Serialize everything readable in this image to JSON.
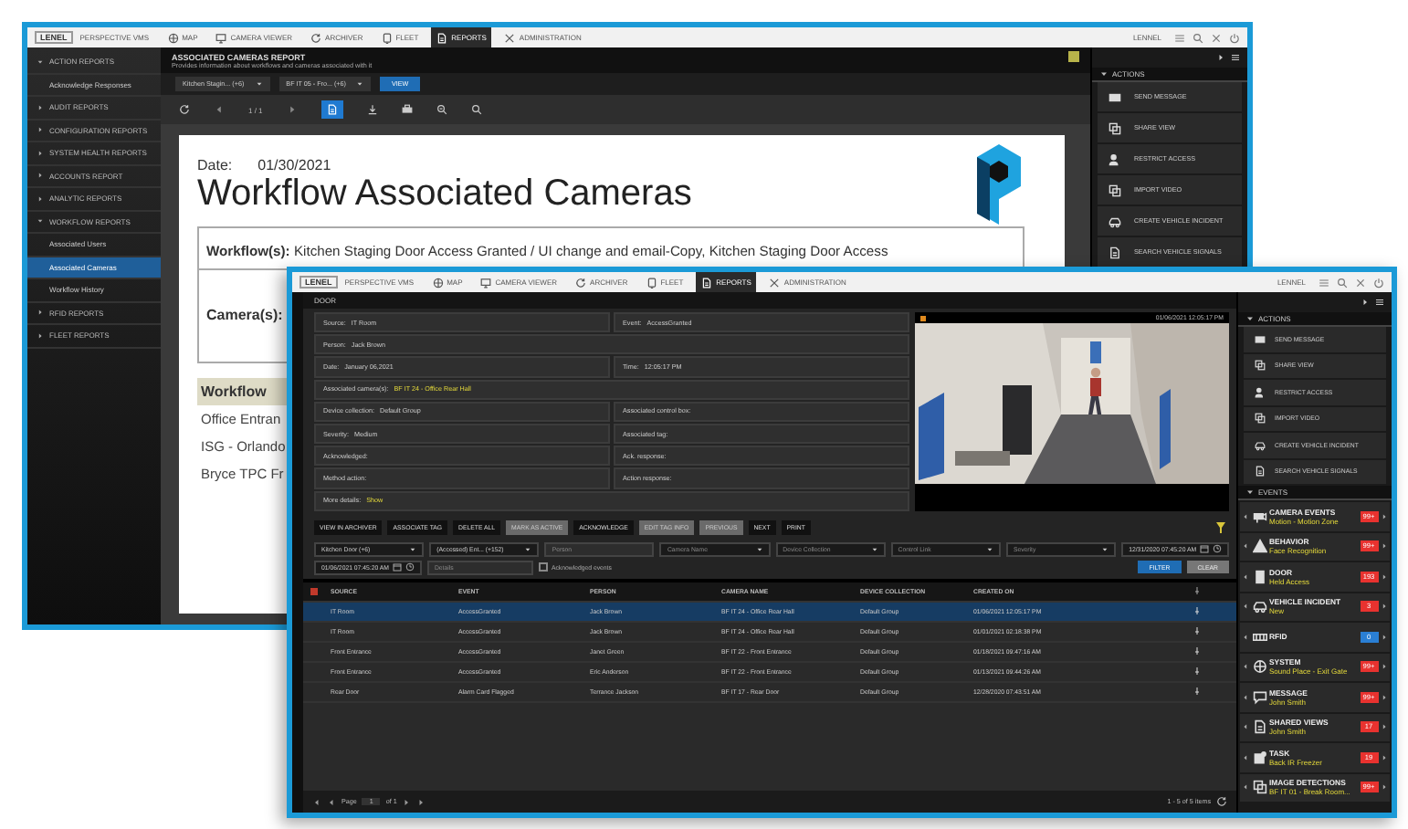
{
  "back_window": {
    "nav": {
      "logo": "LENEL",
      "app": "PERSPECTIVE VMS",
      "user": "LENNEL",
      "tabs": [
        {
          "label": "MAP",
          "selected": false
        },
        {
          "label": "CAMERA VIEWER",
          "selected": false
        },
        {
          "label": "ARCHIVER",
          "selected": false
        },
        {
          "label": "FLEET",
          "selected": false
        },
        {
          "label": "REPORTS",
          "selected": true
        },
        {
          "label": "ADMINISTRATION",
          "selected": false
        }
      ]
    },
    "sidebar": {
      "items": [
        {
          "label": "ACTION REPORTS",
          "selected": false,
          "expanded": true,
          "children": [
            {
              "label": "Acknowledge Responses",
              "selected": false
            }
          ]
        },
        {
          "label": "AUDIT REPORTS",
          "selected": false,
          "expanded": false
        },
        {
          "label": "CONFIGURATION REPORTS",
          "selected": false,
          "expanded": false
        },
        {
          "label": "SYSTEM HEALTH REPORTS",
          "selected": false,
          "expanded": false
        },
        {
          "label": "ACCOUNTS REPORT",
          "selected": false,
          "expanded": false
        },
        {
          "label": "ANALYTIC REPORTS",
          "selected": false,
          "expanded": false
        },
        {
          "label": "WORKFLOW REPORTS",
          "selected": false,
          "expanded": true,
          "children": [
            {
              "label": "Associated Users",
              "selected": false
            },
            {
              "label": "Associated Cameras",
              "selected": true
            },
            {
              "label": "Workflow History",
              "selected": false
            }
          ]
        },
        {
          "label": "RFID REPORTS",
          "selected": false,
          "expanded": false
        },
        {
          "label": "FLEET REPORTS",
          "selected": false,
          "expanded": false
        }
      ]
    },
    "report": {
      "title": "ASSOCIATED CAMERAS REPORT",
      "description": "Provides information about workflows and cameras associated with it",
      "filters": [
        "Kitchen Stagin... (+6)",
        "BF IT 05 - Fro... (+6)"
      ],
      "view_button": "VIEW",
      "page": "1 / 1",
      "document": {
        "date_label": "Date:",
        "date": "01/30/2021",
        "heading": "Workflow Associated Cameras",
        "workflow": "**Workflow(s):** Kitchen Staging Door Access Granted / UI change and email-Copy, Kitchen Staging Door Access",
        "cameras_label": "Camera(s):",
        "table_header": "Workflow",
        "rows": [
          "Office Entran",
          "ISG - Orlando",
          "Bryce TPC Fr"
        ]
      }
    },
    "actions": {
      "title": "ACTIONS",
      "items": [
        "SEND MESSAGE",
        "SHARE VIEW",
        "RESTRICT ACCESS",
        "IMPORT VIDEO",
        "CREATE VEHICLE INCIDENT",
        "SEARCH VEHICLE SIGNALS"
      ]
    }
  },
  "front_window": {
    "nav": {
      "logo": "LENEL",
      "app": "PERSPECTIVE VMS",
      "user": "LENNEL",
      "tabs": [
        {
          "label": "MAP",
          "selected": false
        },
        {
          "label": "CAMERA VIEWER",
          "selected": false
        },
        {
          "label": "ARCHIVER",
          "selected": false
        },
        {
          "label": "FLEET",
          "selected": false
        },
        {
          "label": "REPORTS",
          "selected": true
        },
        {
          "label": "ADMINISTRATION",
          "selected": false
        }
      ]
    },
    "section_title": "DOOR",
    "details": [
      {
        "cells": [
          {
            "label": "Source:",
            "value": "IT Room",
            "kind": "text"
          },
          {
            "label": "Event:",
            "value": "AccessGranted",
            "kind": "text"
          }
        ]
      },
      {
        "cells": [
          {
            "label": "Person:",
            "value": "Jack Brown",
            "kind": "text"
          }
        ]
      },
      {
        "cells": [
          {
            "label": "Date:",
            "value": "January 06,2021",
            "kind": "text"
          },
          {
            "label": "Time:",
            "value": "12:05:17 PM",
            "kind": "text"
          }
        ]
      },
      {
        "cells": [
          {
            "label": "Associated camera(s):",
            "value": "BF IT 24 - Office Rear Hall",
            "kind": "link"
          }
        ]
      },
      {
        "cells": [
          {
            "label": "Device collection:",
            "value": "Default Group",
            "kind": "text"
          },
          {
            "label": "Associated control box:"
          }
        ]
      },
      {
        "cells": [
          {
            "label": "Severity:",
            "value": "Medium",
            "kind": "text"
          },
          {
            "label": "Associated tag:"
          }
        ]
      },
      {
        "cells": [
          {
            "label": "Acknowledged:"
          },
          {
            "label": "Ack. response:"
          }
        ]
      },
      {
        "cells": [
          {
            "label": "Method action:"
          },
          {
            "label": "Action response:"
          }
        ]
      },
      {
        "cells": [
          {
            "label": "More details:",
            "value": "Show",
            "kind": "link"
          }
        ]
      }
    ],
    "video": {
      "timestamp": "01/06/2021 12:05:17 PM"
    },
    "toolbar": [
      {
        "label": "VIEW IN ARCHIVER",
        "disabled": false
      },
      {
        "label": "ASSOCIATE TAG",
        "disabled": false
      },
      {
        "label": "DELETE ALL",
        "disabled": false
      },
      {
        "label": "MARK AS ACTIVE",
        "disabled": true
      },
      {
        "label": "ACKNOWLEDGE",
        "disabled": false
      },
      {
        "label": "EDIT TAG INFO",
        "disabled": true
      },
      {
        "label": "PREVIOUS",
        "disabled": true
      },
      {
        "label": "NEXT",
        "disabled": false
      },
      {
        "label": "PRINT",
        "disabled": false
      }
    ],
    "filters": [
      {
        "kind": "dropdown",
        "value": "Kitchen Door (+6)"
      },
      {
        "kind": "dropdown",
        "value": "(Accessed) Ent... (+152)"
      },
      {
        "kind": "field",
        "placeholder": "Person"
      },
      {
        "kind": "dropdown",
        "placeholder": "Camera Name"
      },
      {
        "kind": "dropdown",
        "placeholder": "Device Collection"
      },
      {
        "kind": "dropdown",
        "placeholder": "Control Link"
      },
      {
        "kind": "dropdown",
        "placeholder": "Severity"
      },
      {
        "kind": "date",
        "value": "12/31/2020 07:45:20 AM"
      }
    ],
    "filters_row2": {
      "date": "01/06/2021 07:45:20 AM",
      "details_placeholder": "Details",
      "checkbox": {
        "label": "Acknowledged events",
        "checked": false
      }
    },
    "filter_button": "FILTER",
    "clear_button": "CLEAR",
    "table": {
      "columns": [
        "SOURCE",
        "EVENT",
        "PERSON",
        "CAMERA NAME",
        "DEVICE COLLECTION",
        "CREATED ON"
      ],
      "rows": [
        {
          "selected": true,
          "cells": [
            "IT Room",
            "AccessGranted",
            "Jack Brown",
            "BF IT 24 - Office Rear Hall",
            "Default Group",
            "01/06/2021 12:05:17 PM"
          ]
        },
        {
          "selected": false,
          "cells": [
            "IT Room",
            "AccessGranted",
            "Jack Brown",
            "BF IT 24 - Office Rear Hall",
            "Default Group",
            "01/01/2021 02:18:38 PM"
          ]
        },
        {
          "selected": false,
          "cells": [
            "Front Entrance",
            "AccessGranted",
            "Janet Green",
            "BF IT 22 - Front Entrance",
            "Default Group",
            "01/18/2021 09:47:16 AM"
          ]
        },
        {
          "selected": false,
          "cells": [
            "Front Entrance",
            "AccessGranted",
            "Eric Anderson",
            "BF IT 22 - Front Entrance",
            "Default Group",
            "01/13/2021 09:44:26 AM"
          ]
        },
        {
          "selected": false,
          "cells": [
            "Rear Door",
            "Alarm Card Flagged",
            "Terrance Jackson",
            "BF IT 17 - Rear Door",
            "Default Group",
            "12/28/2020 07:43:51 AM"
          ]
        }
      ]
    },
    "pager": {
      "page_label": "Page",
      "page": "1",
      "of": "of 1",
      "summary": "1 - 5 of 5 items"
    },
    "actions": {
      "title": "ACTIONS",
      "items": [
        "SEND MESSAGE",
        "SHARE VIEW",
        "RESTRICT ACCESS",
        "IMPORT VIDEO",
        "CREATE VEHICLE INCIDENT",
        "SEARCH VEHICLE SIGNALS"
      ]
    },
    "events": {
      "title": "EVENTS",
      "items": [
        {
          "title": "CAMERA EVENTS",
          "detail": "Motion - Motion Zone",
          "count": "99+",
          "color": "#e8322f"
        },
        {
          "title": "BEHAVIOR",
          "detail": "Face Recognition",
          "count": "99+",
          "color": "#e8322f"
        },
        {
          "title": "DOOR",
          "detail": "Held Access",
          "count": "193",
          "color": "#e8322f"
        },
        {
          "title": "VEHICLE INCIDENT",
          "detail": "New",
          "count": "3",
          "color": "#e8322f"
        },
        {
          "title": "RFID",
          "count": "0",
          "color": "#2a7fd4"
        },
        {
          "title": "SYSTEM",
          "detail": "Sound Place - Exit Gate",
          "count": "99+",
          "color": "#e8322f"
        },
        {
          "title": "MESSAGE",
          "detail": "John Smith",
          "count": "99+",
          "color": "#e8322f"
        },
        {
          "title": "SHARED VIEWS",
          "detail": "John Smith",
          "count": "17",
          "color": "#e8322f"
        },
        {
          "title": "TASK",
          "detail": "Back IR Freezer",
          "count": "19",
          "color": "#e8322f"
        },
        {
          "title": "IMAGE DETECTIONS",
          "detail": "BF IT 01 - Break Room...",
          "count": "99+",
          "color": "#e8322f"
        }
      ]
    }
  }
}
